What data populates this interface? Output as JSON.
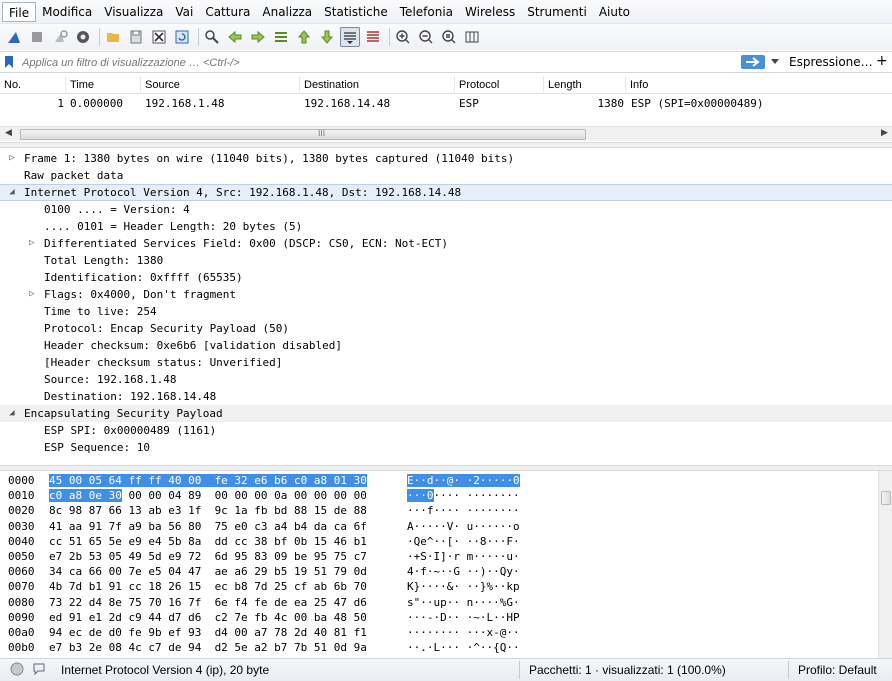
{
  "menu": [
    "File",
    "Modifica",
    "Visualizza",
    "Vai",
    "Cattura",
    "Analizza",
    "Statistiche",
    "Telefonia",
    "Wireless",
    "Strumenti",
    "Aiuto"
  ],
  "filter": {
    "placeholder": "Applica un filtro di visualizzazione … <Ctrl-/>",
    "expression_label": "Espressione…",
    "add_label": "+"
  },
  "packet_list": {
    "columns": [
      "No.",
      "Time",
      "Source",
      "Destination",
      "Protocol",
      "Length",
      "Info"
    ],
    "rows": [
      {
        "no": "1",
        "time": "0.000000",
        "source": "192.168.1.48",
        "destination": "192.168.14.48",
        "protocol": "ESP",
        "length": "1380",
        "info": "ESP (SPI=0x00000489)"
      }
    ],
    "scroll_grip": "III"
  },
  "details": [
    {
      "text": "Frame 1: 1380 bytes on wire (11040 bits), 1380 bytes captured (11040 bits)",
      "toggle": "collapsed"
    },
    {
      "text": "Raw packet data",
      "toggle": "none"
    },
    {
      "text": "Internet Protocol Version 4, Src: 192.168.1.48, Dst: 192.168.14.48",
      "toggle": "expanded"
    },
    {
      "text": "0100 .... = Version: 4",
      "toggle": "none"
    },
    {
      "text": ".... 0101 = Header Length: 20 bytes (5)",
      "toggle": "none"
    },
    {
      "text": "Differentiated Services Field: 0x00 (DSCP: CS0, ECN: Not-ECT)",
      "toggle": "collapsed"
    },
    {
      "text": "Total Length: 1380",
      "toggle": "none"
    },
    {
      "text": "Identification: 0xffff (65535)",
      "toggle": "none"
    },
    {
      "text": "Flags: 0x4000, Don't fragment",
      "toggle": "collapsed"
    },
    {
      "text": "Time to live: 254",
      "toggle": "none"
    },
    {
      "text": "Protocol: Encap Security Payload (50)",
      "toggle": "none"
    },
    {
      "text": "Header checksum: 0xe6b6 [validation disabled]",
      "toggle": "none"
    },
    {
      "text": "[Header checksum status: Unverified]",
      "toggle": "none"
    },
    {
      "text": "Source: 192.168.1.48",
      "toggle": "none"
    },
    {
      "text": "Destination: 192.168.14.48",
      "toggle": "none"
    },
    {
      "text": "Encapsulating Security Payload",
      "toggle": "expanded"
    },
    {
      "text": "ESP SPI: 0x00000489 (1161)",
      "toggle": "none"
    },
    {
      "text": "ESP Sequence: 10",
      "toggle": "none"
    }
  ],
  "hex": [
    {
      "off": "0000",
      "sel_bytes": "45 00 05 64 ff ff 40 00  fe 32 e6 b6 c0 a8 01 30",
      "bytes": "",
      "sel_ascii": "E··d··@· ·2·····0",
      "ascii": ""
    },
    {
      "off": "0010",
      "sel_bytes": "c0 a8 0e 30",
      "bytes": " 00 00 04 89  00 00 00 0a 00 00 00 00",
      "sel_ascii": "···0",
      "ascii": "···· ········"
    },
    {
      "off": "0020",
      "sel_bytes": "",
      "bytes": "8c 98 87 66 13 ab e3 1f  9c 1a fb bd 88 15 de 88",
      "sel_ascii": "",
      "ascii": "···f···· ········"
    },
    {
      "off": "0030",
      "sel_bytes": "",
      "bytes": "41 aa 91 7f a9 ba 56 80  75 e0 c3 a4 b4 da ca 6f",
      "sel_ascii": "",
      "ascii": "A·····V· u······o"
    },
    {
      "off": "0040",
      "sel_bytes": "",
      "bytes": "cc 51 65 5e e9 e4 5b 8a  dd cc 38 bf 0b 15 46 b1",
      "sel_ascii": "",
      "ascii": "·Qe^··[· ··8···F·"
    },
    {
      "off": "0050",
      "sel_bytes": "",
      "bytes": "e7 2b 53 05 49 5d e9 72  6d 95 83 09 be 95 75 c7",
      "sel_ascii": "",
      "ascii": "·+S·I]·r m·····u·"
    },
    {
      "off": "0060",
      "sel_bytes": "",
      "bytes": "34 ca 66 00 7e e5 04 47  ae a6 29 b5 19 51 79 0d",
      "sel_ascii": "",
      "ascii": "4·f·~··G ··)··Qy·"
    },
    {
      "off": "0070",
      "sel_bytes": "",
      "bytes": "4b 7d b1 91 cc 18 26 15  ec b8 7d 25 cf ab 6b 70",
      "sel_ascii": "",
      "ascii": "K}····&· ··}%··kp"
    },
    {
      "off": "0080",
      "sel_bytes": "",
      "bytes": "73 22 d4 8e 75 70 16 7f  6e f4 fe de ea 25 47 d6",
      "sel_ascii": "",
      "ascii": "s\"··up·· n····%G·"
    },
    {
      "off": "0090",
      "sel_bytes": "",
      "bytes": "ed 91 e1 2d c9 44 d7 d6  c2 7e fb 4c 00 ba 48 50",
      "sel_ascii": "",
      "ascii": "···-·D·· ·~·L··HP"
    },
    {
      "off": "00a0",
      "sel_bytes": "",
      "bytes": "94 ec de d0 fe 9b ef 93  d4 00 a7 78 2d 40 81 f1",
      "sel_ascii": "",
      "ascii": "········ ···x-@··"
    },
    {
      "off": "00b0",
      "sel_bytes": "",
      "bytes": "e7 b3 2e 08 4c c7 de 94  d2 5e a2 b7 7b 51 0d 9a",
      "sel_ascii": "",
      "ascii": "··.·L··· ·^··{Q··"
    }
  ],
  "status": {
    "left": "Internet Protocol Version 4 (ip), 20 byte",
    "packets": "Pacchetti: 1 · visualizzati: 1 (100.0%)",
    "profile": "Profilo: Default"
  },
  "colors": {
    "accent": "#3f8ee8",
    "highlight": "#e6eff9",
    "apply": "#4a90d9"
  }
}
